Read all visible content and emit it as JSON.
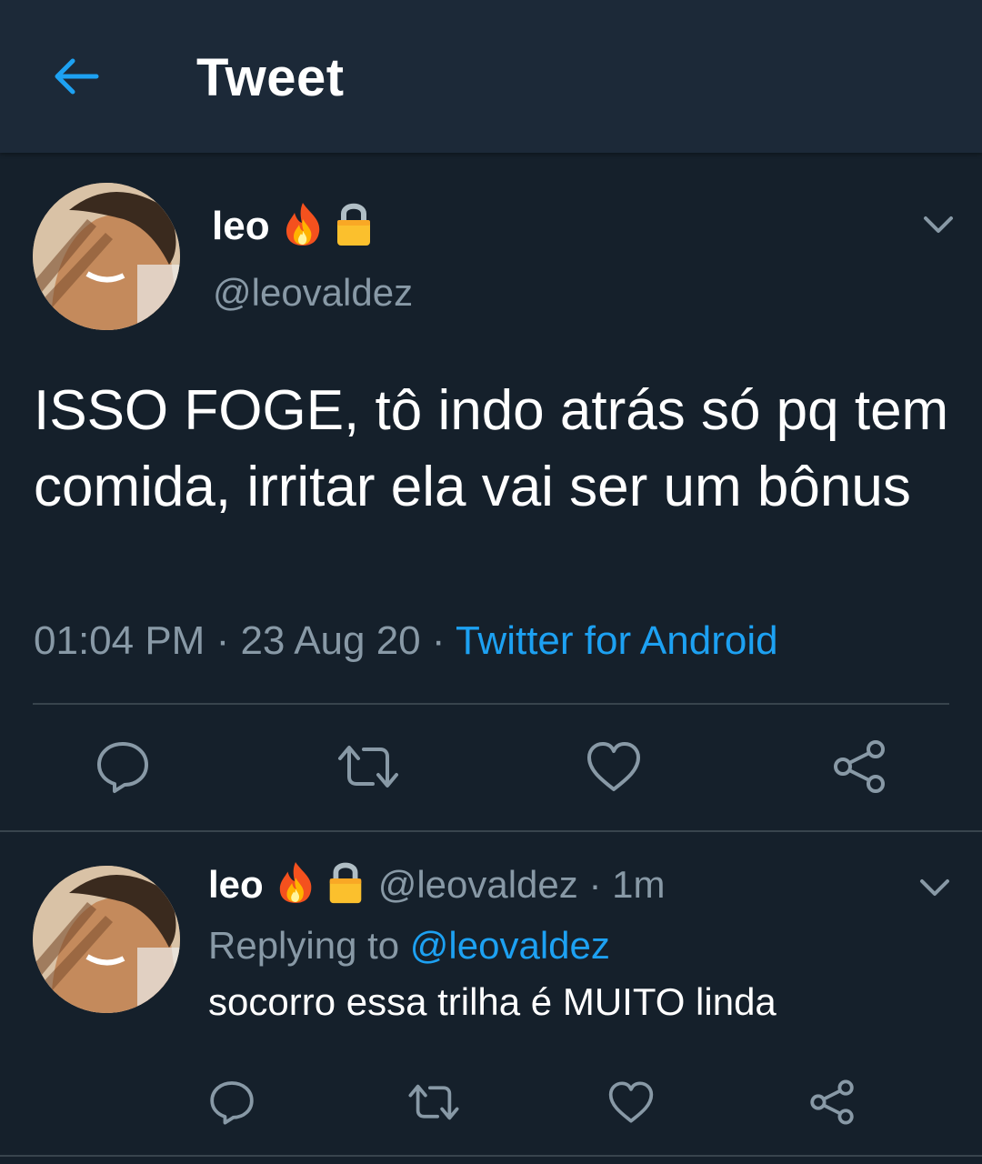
{
  "header": {
    "title": "Tweet",
    "back_icon": "arrow-left-icon",
    "accent_color": "#1da1f2"
  },
  "main_tweet": {
    "display_name": "leo",
    "emojis": [
      "fire-emoji",
      "lock-emoji"
    ],
    "handle": "@leovaldez",
    "text": "ISSO FOGE, tô indo atrás só pq tem comida, irritar ela vai ser um bônus",
    "time": "01:04 PM",
    "date": "23 Aug 20",
    "separator": " · ",
    "source": "Twitter for Android",
    "actions": [
      "reply-icon",
      "retweet-icon",
      "like-icon",
      "share-icon"
    ]
  },
  "reply_tweet": {
    "display_name": "leo",
    "emojis": [
      "fire-emoji",
      "lock-emoji"
    ],
    "handle_and_time": "@leovaldez · 1m",
    "replying_prefix": "Replying to ",
    "replying_to": "@leovaldez",
    "text": "socorro essa trilha é MUITO linda",
    "actions": [
      "reply-icon",
      "retweet-icon",
      "like-icon",
      "share-icon"
    ]
  },
  "colors": {
    "background": "#15202b",
    "header_background": "#1c2938",
    "secondary_text": "#8899a6",
    "link": "#1da1f2",
    "divider": "#38444d"
  }
}
